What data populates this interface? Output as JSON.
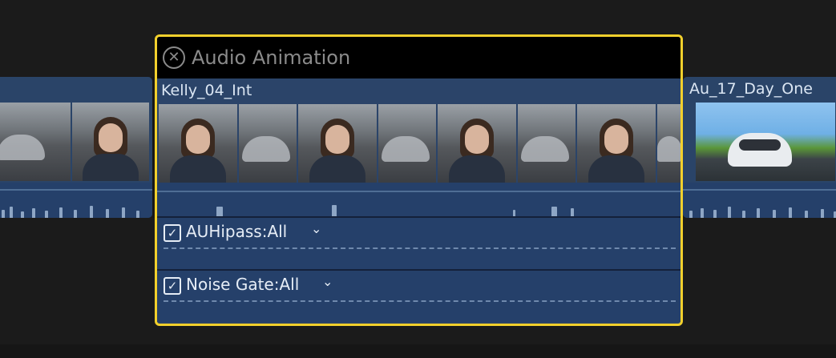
{
  "animation_header": {
    "title": "Audio Animation",
    "close_glyph": "✕"
  },
  "selected_clip": {
    "name": "Kelly_04_Int"
  },
  "left_clip": {
    "name": ""
  },
  "right_clip": {
    "name": "Au_17_Day_One"
  },
  "effects": [
    {
      "label": "AUHipass:All",
      "checked": true,
      "chevron": "⌄"
    },
    {
      "label": "Noise Gate:All",
      "checked": true,
      "chevron": "⌄"
    }
  ],
  "colors": {
    "selection_border": "#f2d02c",
    "clip_fill": "#2b4469",
    "audio_band": "#25406a",
    "header_bg": "#000000"
  },
  "icons": [
    "close-circle-icon",
    "checkbox-checked-icon",
    "chevron-down-icon"
  ]
}
